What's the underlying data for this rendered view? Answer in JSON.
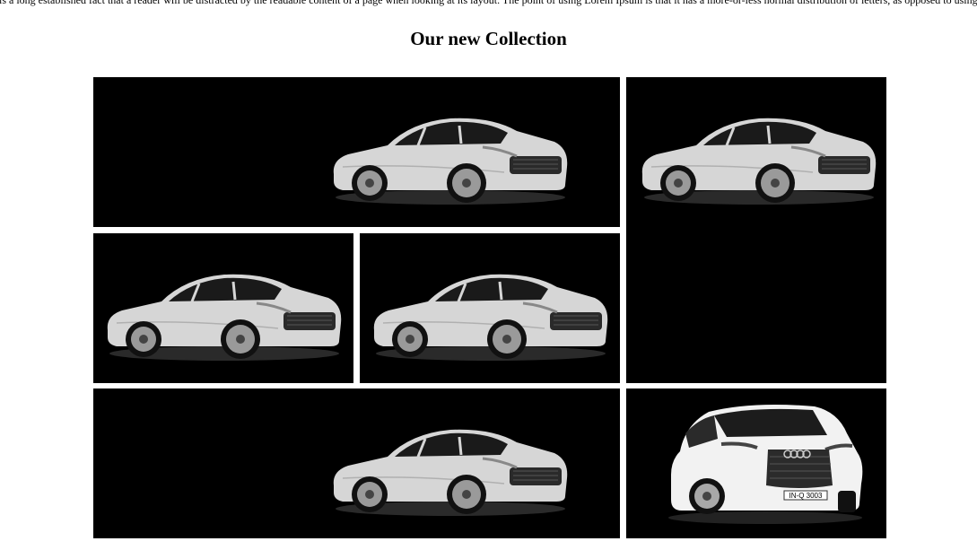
{
  "intro_text": "is a long established fact that a reader will be distracted by the readable content of a page when looking at its layout. The point of using Lorem Ipsum is that it has a more-or-less normal distribution of letters, as opposed to using 'Content here, content here', making",
  "heading": "Our new Collection",
  "tiles": [
    {
      "image": "silver-sedan-car"
    },
    {
      "image": "silver-sedan-car"
    },
    {
      "image": "silver-sedan-car"
    },
    {
      "image": "silver-sedan-car"
    },
    {
      "image": "silver-sedan-car"
    },
    {
      "image": "white-suv-car",
      "plate": "IN-Q 3003"
    }
  ],
  "colors": {
    "tile_background": "#000000",
    "page_background": "#ffffff",
    "car_body": "#d8d8d8"
  }
}
